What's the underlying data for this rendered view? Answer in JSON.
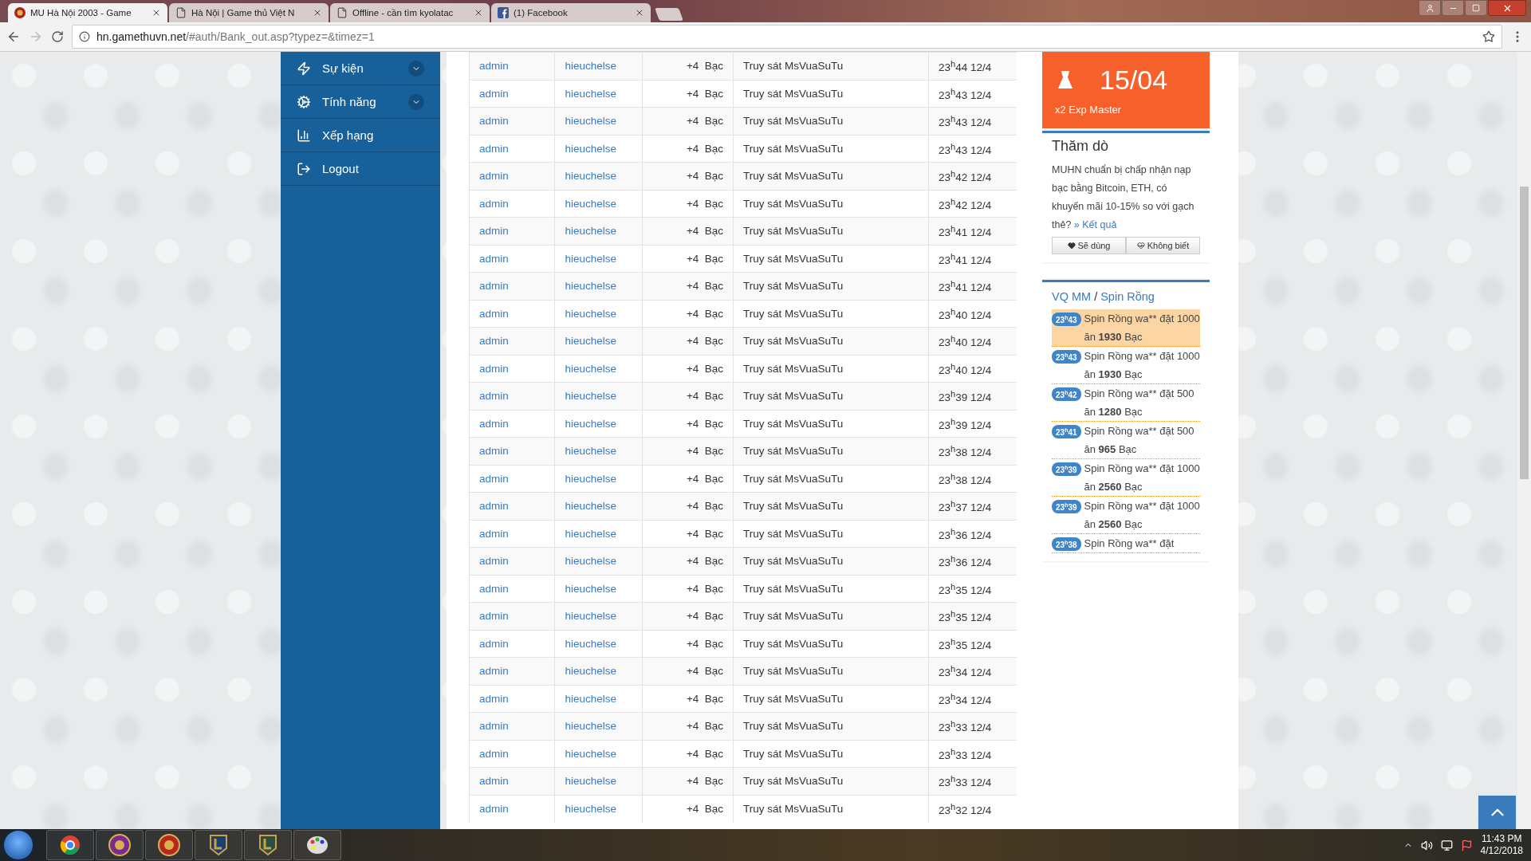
{
  "browser": {
    "tabs": [
      {
        "title": "MU Hà Nội 2003 - Game",
        "selected": true
      },
      {
        "title": "Hà Nội | Game thủ Việt N",
        "selected": false
      },
      {
        "title": "Offline - cần tìm kyolatac",
        "selected": false
      },
      {
        "title": "(1) Facebook",
        "selected": false
      }
    ],
    "url_host": "hn.gamethuvn.net",
    "url_path": "/#auth/Bank_out.asp?typez=&timez=1"
  },
  "sidebar": {
    "items": [
      {
        "label": "Sự kiện",
        "has_submenu": true
      },
      {
        "label": "Tính năng",
        "has_submenu": true
      },
      {
        "label": "Xếp hạng",
        "has_submenu": false
      },
      {
        "label": "Logout",
        "has_submenu": false
      }
    ]
  },
  "table": {
    "rows": [
      {
        "sender": "admin",
        "receiver": "hieuchelse",
        "amount": "+4  Bạc",
        "note": "Truy sát MsVuaSuTu",
        "time": "23$^{h}$44 12/4"
      },
      {
        "sender": "admin",
        "receiver": "hieuchelse",
        "amount": "+4  Bạc",
        "note": "Truy sát MsVuaSuTu",
        "time": "23$^{h}$43 12/4"
      },
      {
        "sender": "admin",
        "receiver": "hieuchelse",
        "amount": "+4  Bạc",
        "note": "Truy sát MsVuaSuTu",
        "time": "23$^{h}$43 12/4"
      },
      {
        "sender": "admin",
        "receiver": "hieuchelse",
        "amount": "+4  Bạc",
        "note": "Truy sát MsVuaSuTu",
        "time": "23$^{h}$43 12/4"
      },
      {
        "sender": "admin",
        "receiver": "hieuchelse",
        "amount": "+4  Bạc",
        "note": "Truy sát MsVuaSuTu",
        "time": "23$^{h}$42 12/4"
      },
      {
        "sender": "admin",
        "receiver": "hieuchelse",
        "amount": "+4  Bạc",
        "note": "Truy sát MsVuaSuTu",
        "time": "23$^{h}$42 12/4"
      },
      {
        "sender": "admin",
        "receiver": "hieuchelse",
        "amount": "+4  Bạc",
        "note": "Truy sát MsVuaSuTu",
        "time": "23$^{h}$41 12/4"
      },
      {
        "sender": "admin",
        "receiver": "hieuchelse",
        "amount": "+4  Bạc",
        "note": "Truy sát MsVuaSuTu",
        "time": "23$^{h}$41 12/4"
      },
      {
        "sender": "admin",
        "receiver": "hieuchelse",
        "amount": "+4  Bạc",
        "note": "Truy sát MsVuaSuTu",
        "time": "23$^{h}$41 12/4"
      },
      {
        "sender": "admin",
        "receiver": "hieuchelse",
        "amount": "+4  Bạc",
        "note": "Truy sát MsVuaSuTu",
        "time": "23$^{h}$40 12/4"
      },
      {
        "sender": "admin",
        "receiver": "hieuchelse",
        "amount": "+4  Bạc",
        "note": "Truy sát MsVuaSuTu",
        "time": "23$^{h}$40 12/4"
      },
      {
        "sender": "admin",
        "receiver": "hieuchelse",
        "amount": "+4  Bạc",
        "note": "Truy sát MsVuaSuTu",
        "time": "23$^{h}$40 12/4"
      },
      {
        "sender": "admin",
        "receiver": "hieuchelse",
        "amount": "+4  Bạc",
        "note": "Truy sát MsVuaSuTu",
        "time": "23$^{h}$39 12/4"
      },
      {
        "sender": "admin",
        "receiver": "hieuchelse",
        "amount": "+4  Bạc",
        "note": "Truy sát MsVuaSuTu",
        "time": "23$^{h}$39 12/4"
      },
      {
        "sender": "admin",
        "receiver": "hieuchelse",
        "amount": "+4  Bạc",
        "note": "Truy sát MsVuaSuTu",
        "time": "23$^{h}$38 12/4"
      },
      {
        "sender": "admin",
        "receiver": "hieuchelse",
        "amount": "+4  Bạc",
        "note": "Truy sát MsVuaSuTu",
        "time": "23$^{h}$38 12/4"
      },
      {
        "sender": "admin",
        "receiver": "hieuchelse",
        "amount": "+4  Bạc",
        "note": "Truy sát MsVuaSuTu",
        "time": "23$^{h}$37 12/4"
      },
      {
        "sender": "admin",
        "receiver": "hieuchelse",
        "amount": "+4  Bạc",
        "note": "Truy sát MsVuaSuTu",
        "time": "23$^{h}$36 12/4"
      },
      {
        "sender": "admin",
        "receiver": "hieuchelse",
        "amount": "+4  Bạc",
        "note": "Truy sát MsVuaSuTu",
        "time": "23$^{h}$36 12/4"
      },
      {
        "sender": "admin",
        "receiver": "hieuchelse",
        "amount": "+4  Bạc",
        "note": "Truy sát MsVuaSuTu",
        "time": "23$^{h}$35 12/4"
      },
      {
        "sender": "admin",
        "receiver": "hieuchelse",
        "amount": "+4  Bạc",
        "note": "Truy sát MsVuaSuTu",
        "time": "23$^{h}$35 12/4"
      },
      {
        "sender": "admin",
        "receiver": "hieuchelse",
        "amount": "+4  Bạc",
        "note": "Truy sát MsVuaSuTu",
        "time": "23$^{h}$35 12/4"
      },
      {
        "sender": "admin",
        "receiver": "hieuchelse",
        "amount": "+4  Bạc",
        "note": "Truy sát MsVuaSuTu",
        "time": "23$^{h}$34 12/4"
      },
      {
        "sender": "admin",
        "receiver": "hieuchelse",
        "amount": "+4  Bạc",
        "note": "Truy sát MsVuaSuTu",
        "time": "23$^{h}$34 12/4"
      },
      {
        "sender": "admin",
        "receiver": "hieuchelse",
        "amount": "+4  Bạc",
        "note": "Truy sát MsVuaSuTu",
        "time": "23$^{h}$33 12/4"
      },
      {
        "sender": "admin",
        "receiver": "hieuchelse",
        "amount": "+4  Bạc",
        "note": "Truy sát MsVuaSuTu",
        "time": "23$^{h}$33 12/4"
      },
      {
        "sender": "admin",
        "receiver": "hieuchelse",
        "amount": "+4  Bạc",
        "note": "Truy sát MsVuaSuTu",
        "time": "23$^{h}$33 12/4"
      },
      {
        "sender": "admin",
        "receiver": "hieuchelse",
        "amount": "+4  Bạc",
        "note": "Truy sát MsVuaSuTu",
        "time": "23$^{h}$32 12/4"
      }
    ]
  },
  "promo": {
    "date": "15/04",
    "caption": "x2 Exp Master"
  },
  "poll": {
    "title": "Thăm dò",
    "question": "MUHN chuẩn bị chấp nhận nạp bạc bằng Bitcoin, ETH, có khuyến mãi 10-15% so với gạch thẻ?",
    "results_link": "» Kết quả",
    "buttons": [
      "Sẽ dùng",
      "Không biết"
    ]
  },
  "spin": {
    "title_left": "VQ MM",
    "separator": "/",
    "title_right": "Spin Rồng",
    "items": [
      {
        "time": "23$^{h}$43",
        "text": "Spin Rồng wa** đặt 1000 ăn **1930** Bạc",
        "highlighted": true
      },
      {
        "time": "23$^{h}$43",
        "text": "Spin Rồng wa** đặt 1000 ăn **1930** Bạc",
        "highlighted": false
      },
      {
        "time": "23$^{h}$42",
        "text": "Spin Rồng wa** đặt 500 ăn **1280** Bạc",
        "highlighted": false
      },
      {
        "time": "23$^{h}$41",
        "text": "Spin Rồng wa** đặt 500 ăn **965** Bạc",
        "highlighted": false
      },
      {
        "time": "23$^{h}$39",
        "text": "Spin Rồng wa** đặt 1000 ăn **2560** Bạc",
        "highlighted": false
      },
      {
        "time": "23$^{h}$39",
        "text": "Spin Rồng wa** đặt 1000 ăn **2560** Bạc",
        "highlighted": false
      },
      {
        "time": "23$^{h}$38",
        "text": "Spin Rồng wa** đặt",
        "highlighted": false
      }
    ]
  },
  "taskbar": {
    "time": "11:43 PM",
    "date": "4/12/2018"
  }
}
